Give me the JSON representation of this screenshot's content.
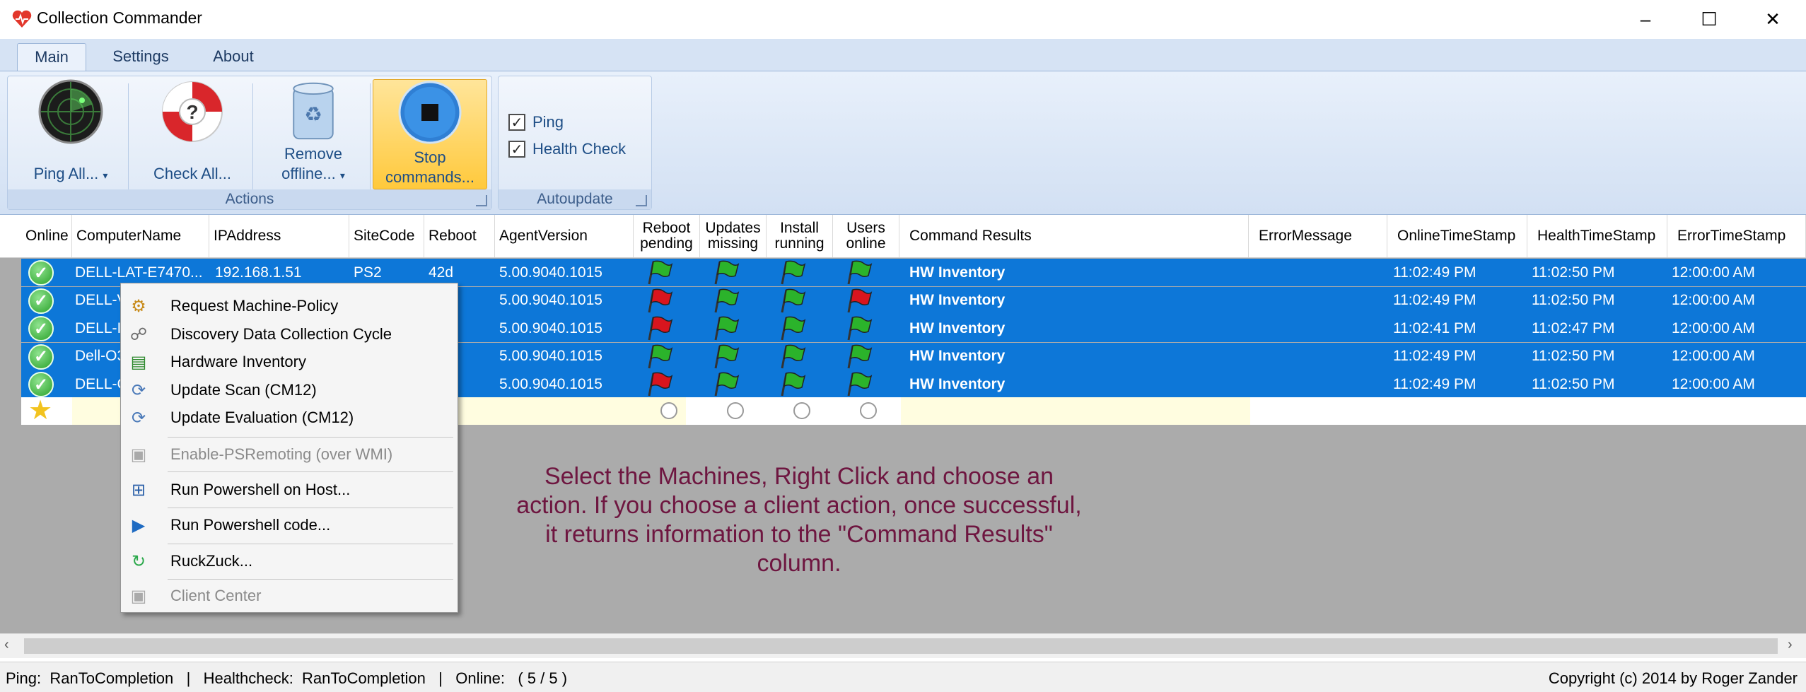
{
  "window": {
    "title": "Collection Commander",
    "controls": {
      "minimize": "–",
      "maximize": "☐",
      "close": "✕"
    }
  },
  "ribbon": {
    "tabs": [
      "Main",
      "Settings",
      "About"
    ],
    "actions": {
      "group_label": "Actions",
      "ping_all": "Ping All...",
      "check_all": "Check All...",
      "remove_offline_1": "Remove",
      "remove_offline_2": "offline...",
      "stop_commands_1": "Stop",
      "stop_commands_2": "commands..."
    },
    "autoupdate": {
      "group_label": "Autoupdate",
      "ping": {
        "label": "Ping",
        "checked": true
      },
      "health_check": {
        "label": "Health Check",
        "checked": true
      }
    }
  },
  "grid": {
    "headers": {
      "online": "Online",
      "computer_name": "ComputerName",
      "ip_address": "IPAddress",
      "site_code": "SiteCode",
      "reboot": "Reboot",
      "agent_version": "AgentVersion",
      "reboot_pending_1": "Reboot",
      "reboot_pending_2": "pending",
      "updates_missing_1": "Updates",
      "updates_missing_2": "missing",
      "install_running_1": "Install",
      "install_running_2": "running",
      "users_online_1": "Users",
      "users_online_2": "online",
      "command_results": "Command Results",
      "error_message": "ErrorMessage",
      "online_ts": "OnlineTimeStamp",
      "health_ts": "HealthTimeStamp",
      "error_ts": "ErrorTimeStamp"
    },
    "rows": [
      {
        "name": "DELL-LAT-E7470...",
        "ip": "192.168.1.51",
        "site": "PS2",
        "reboot": "42d",
        "agent": "5.00.9040.1015",
        "flags": [
          "green",
          "green",
          "green",
          "green"
        ],
        "result": "HW Inventory",
        "online_ts": "11:02:49 PM",
        "health_ts": "11:02:50 PM",
        "error_ts": "12:00:00 AM"
      },
      {
        "name": "DELL-V",
        "ip": "",
        "site": "",
        "reboot": "",
        "agent": "5.00.9040.1015",
        "flags": [
          "red",
          "green",
          "green",
          "red"
        ],
        "result": "HW Inventory",
        "online_ts": "11:02:49 PM",
        "health_ts": "11:02:50 PM",
        "error_ts": "12:00:00 AM"
      },
      {
        "name": "DELL-I",
        "ip": "",
        "site": "",
        "reboot": "",
        "agent": "5.00.9040.1015",
        "flags": [
          "red",
          "green",
          "green",
          "green"
        ],
        "result": "HW Inventory",
        "online_ts": "11:02:41 PM",
        "health_ts": "11:02:47 PM",
        "error_ts": "12:00:00 AM"
      },
      {
        "name": "Dell-O3",
        "ip": "",
        "site": "",
        "reboot": "",
        "agent": "5.00.9040.1015",
        "flags": [
          "green",
          "green",
          "green",
          "green"
        ],
        "result": "HW Inventory",
        "online_ts": "11:02:49 PM",
        "health_ts": "11:02:50 PM",
        "error_ts": "12:00:00 AM"
      },
      {
        "name": "DELL-C",
        "ip": "",
        "site": "",
        "reboot": "",
        "agent": "5.00.9040.1015",
        "flags": [
          "red",
          "green",
          "green",
          "green"
        ],
        "result": "HW Inventory",
        "online_ts": "11:02:49 PM",
        "health_ts": "11:02:50 PM",
        "error_ts": "12:00:00 AM"
      }
    ],
    "hint_text": "Select the Machines, Right Click and choose an action.  If you choose a client action, once successful, it returns information to the \"Command Results\" column."
  },
  "context_menu": {
    "items": [
      {
        "label": "Request Machine-Policy",
        "icon": "policy-icon",
        "enabled": true
      },
      {
        "label": "Discovery Data Collection Cycle",
        "icon": "discovery-icon",
        "enabled": true
      },
      {
        "label": "Hardware Inventory",
        "icon": "hardware-icon",
        "enabled": true
      },
      {
        "label": "Update Scan (CM12)",
        "icon": "update-scan-icon",
        "enabled": true
      },
      {
        "label": "Update Evaluation (CM12)",
        "icon": "update-eval-icon",
        "enabled": true
      },
      {
        "label": "Enable-PSRemoting (over WMI)",
        "icon": "psremoting-icon",
        "enabled": false
      },
      {
        "label": "Run Powershell on Host...",
        "icon": "powershell-host-icon",
        "enabled": true
      },
      {
        "label": "Run Powershell code...",
        "icon": "powershell-code-icon",
        "enabled": true
      },
      {
        "label": "RuckZuck...",
        "icon": "ruckzuck-icon",
        "enabled": true
      },
      {
        "label": "Client Center",
        "icon": "client-center-icon",
        "enabled": false
      }
    ]
  },
  "status_bar": {
    "text": "Ping:  RanToCompletion   |   Healthcheck:  RanToCompletion   |   Online:   ( 5 / 5 )",
    "copyright": "Copyright (c) 2014 by Roger Zander"
  },
  "colors": {
    "selection": "#0d77d8",
    "flag_green": "#2bb32b",
    "flag_red": "#d8151e",
    "hint": "#6e1640"
  }
}
